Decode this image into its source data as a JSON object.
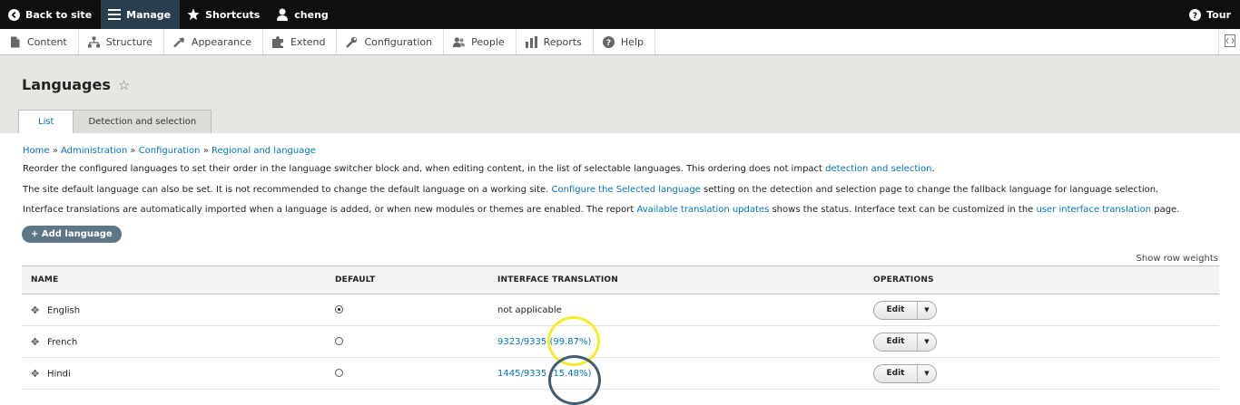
{
  "toolbar": {
    "back": "Back to site",
    "manage": "Manage",
    "shortcuts": "Shortcuts",
    "user": "cheng",
    "tour": "Tour"
  },
  "tray": {
    "items": [
      {
        "label": "Content",
        "icon": "content-icon"
      },
      {
        "label": "Structure",
        "icon": "structure-icon"
      },
      {
        "label": "Appearance",
        "icon": "appearance-icon"
      },
      {
        "label": "Extend",
        "icon": "extend-icon"
      },
      {
        "label": "Configuration",
        "icon": "configuration-icon"
      },
      {
        "label": "People",
        "icon": "people-icon"
      },
      {
        "label": "Reports",
        "icon": "reports-icon"
      },
      {
        "label": "Help",
        "icon": "help-icon"
      }
    ]
  },
  "page": {
    "title": "Languages",
    "tabs": [
      "List",
      "Detection and selection"
    ]
  },
  "breadcrumb": [
    "Home",
    "Administration",
    "Configuration",
    "Regional and language"
  ],
  "description": {
    "p1_text": "Reorder the configured languages to set their order in the language switcher block and, when editing content, in the list of selectable languages. This ordering does not impact ",
    "p1_link": "detection and selection",
    "p1_end": ".",
    "p2_text": "The site default language can also be set. It is not recommended to change the default language on a working site. ",
    "p2_link": "Configure the Selected language",
    "p2_end": " setting on the detection and selection page to change the fallback language for language selection.",
    "p3_text": "Interface translations are automatically imported when a language is added, or when new modules or themes are enabled. The report ",
    "p3_link1": "Available translation updates",
    "p3_mid": " shows the status. Interface text can be customized in the ",
    "p3_link2": "user interface translation",
    "p3_end": " page."
  },
  "add_language": "+ Add language",
  "show_row_weights": "Show row weights",
  "table": {
    "headers": [
      "NAME",
      "DEFAULT",
      "INTERFACE TRANSLATION",
      "OPERATIONS"
    ],
    "rows": [
      {
        "name": "English",
        "default": true,
        "translation": "not applicable",
        "translation_link": false,
        "op": "Edit"
      },
      {
        "name": "French",
        "default": false,
        "translation": "9323/9335 (99.87%)",
        "translation_link": true,
        "op": "Edit"
      },
      {
        "name": "Hindi",
        "default": false,
        "translation": "1445/9335 (15.48%)",
        "translation_link": true,
        "op": "Edit"
      }
    ]
  },
  "colors": {
    "toolbar_bg": "#0f0f0f",
    "manage_active": "#2b3e50",
    "link": "#0074bd",
    "button": "#5f7686",
    "annotation_yellow": "#f3ec27",
    "annotation_blue": "#3f5c73"
  }
}
